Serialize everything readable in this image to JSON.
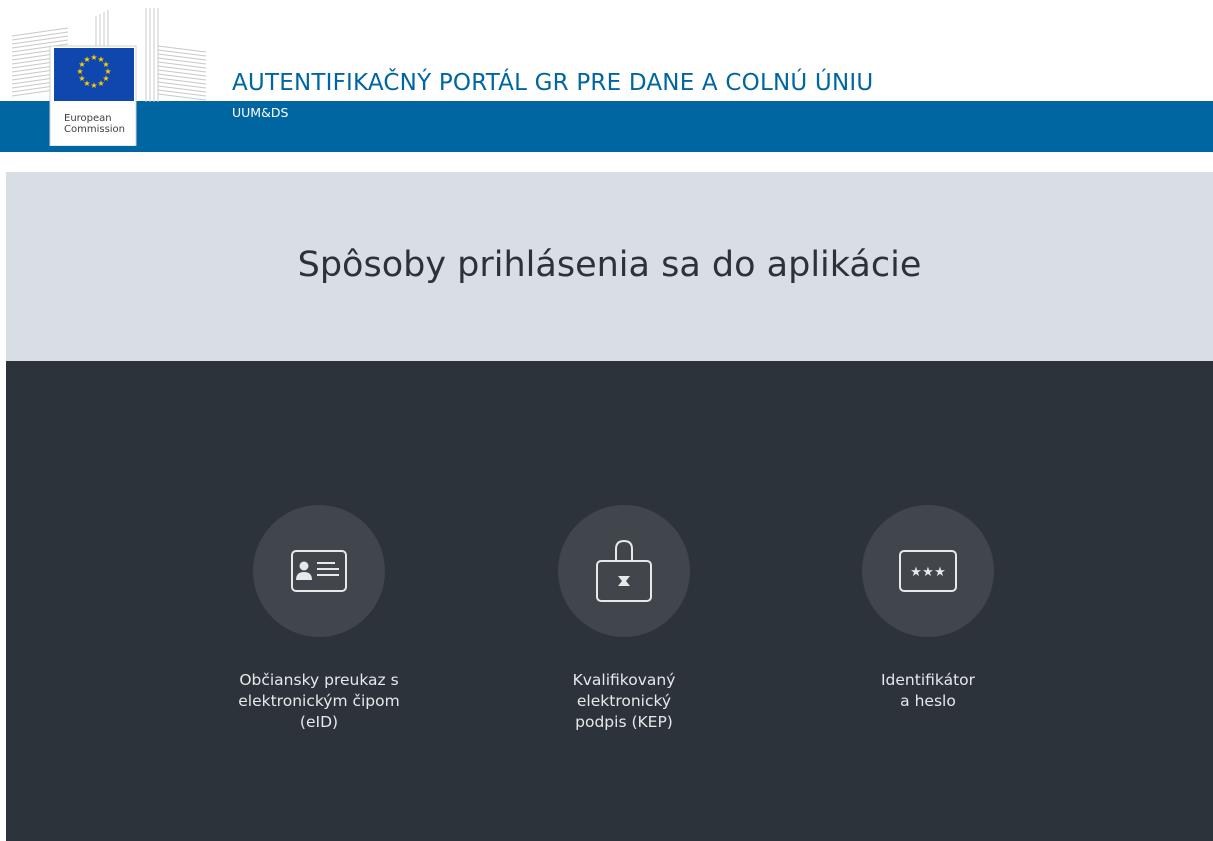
{
  "header": {
    "logo": {
      "line1": "European",
      "line2": "Commission"
    },
    "title": "AUTENTIFIKAČNÝ PORTÁL GR PRE DANE A COLNÚ ÚNIU",
    "subtitle": "UUM&DS"
  },
  "main": {
    "title": "Spôsoby prihlásenia sa do aplikácie"
  },
  "login_options": [
    {
      "icon": "id-card-icon",
      "label_lines": [
        "Občiansky preukaz s",
        "elektronickým čipom",
        "(eID)"
      ]
    },
    {
      "icon": "signature-lock-icon",
      "label_lines": [
        "Kvalifikovaný",
        "elektronický",
        "podpis (KEP)"
      ]
    },
    {
      "icon": "password-icon",
      "label_lines": [
        "Identifikátor",
        "a heslo"
      ]
    }
  ],
  "colors": {
    "brand_blue": "#0066a2",
    "title_band": "#d9dee5",
    "dark_band": "#2d333a",
    "icon_circle": "#40464c"
  }
}
